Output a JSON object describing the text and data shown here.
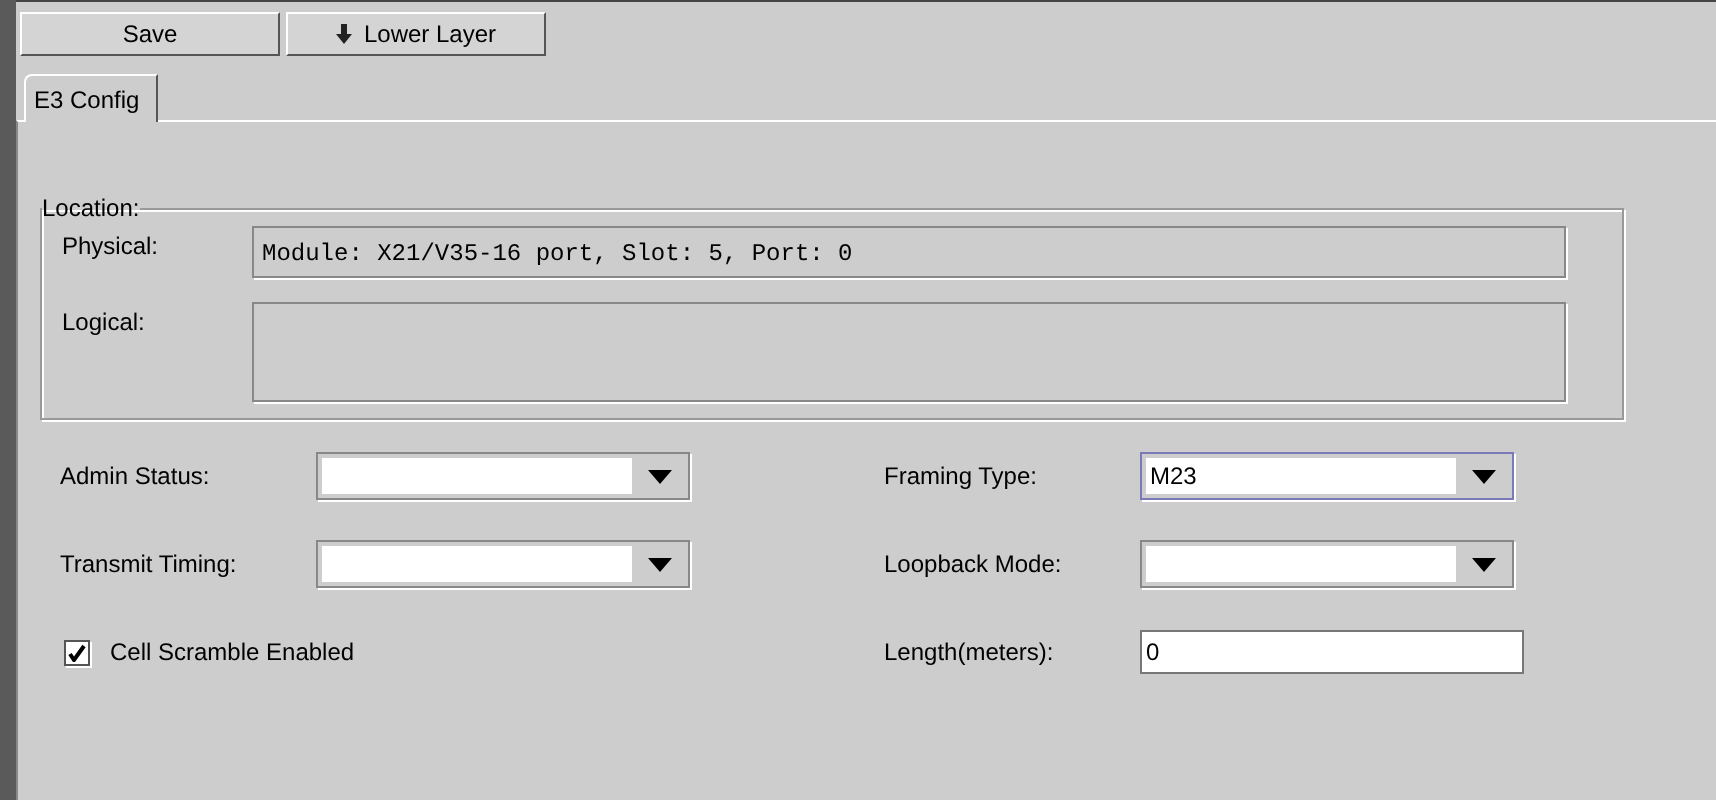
{
  "toolbar": [
    {
      "label": "Save",
      "kind": "plain"
    },
    {
      "label": "Lower Layer",
      "kind": "with-icon"
    }
  ],
  "tabs": [
    {
      "label": "E3 Config",
      "selected": true
    }
  ],
  "location": {
    "title": "Location:",
    "fields": [
      {
        "label": "Physical:",
        "value": "Module: X21/V35-16 port, Slot: 5, Port: 0",
        "kind": "single"
      },
      {
        "label": "Logical:",
        "kind": "multi"
      }
    ]
  },
  "left_fields": [
    {
      "label": "Admin Status:",
      "kind": "combo"
    },
    {
      "label": "Transmit Timing:",
      "kind": "combo"
    },
    {
      "label": "Cell Scramble Enabled",
      "kind": "checkbox",
      "checked": true
    }
  ],
  "right_fields": [
    {
      "label": "Framing Type:",
      "kind": "combo",
      "value": "M23",
      "focused": true
    },
    {
      "label": "Loopback Mode:",
      "kind": "combo"
    },
    {
      "label": "Length(meters):",
      "kind": "text",
      "value": "0"
    }
  ]
}
